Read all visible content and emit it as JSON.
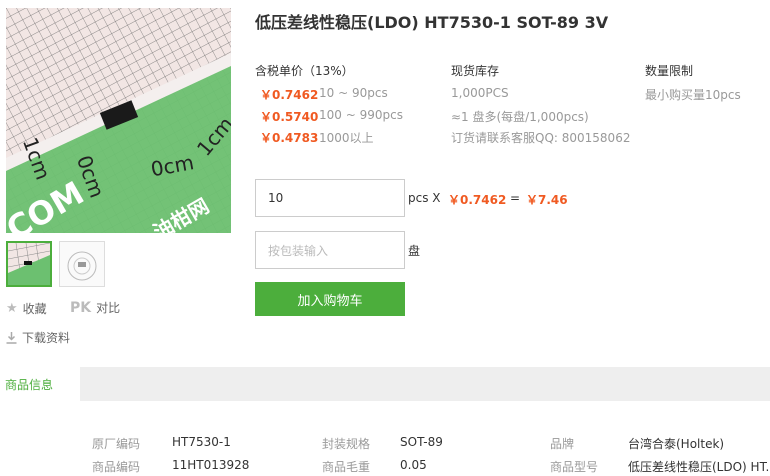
{
  "product": {
    "title": "低压差线性稳压(LDO) HT7530-1 SOT-89 3V",
    "image_text": {
      "cm_a": "1cm",
      "cm_b": "0cm",
      "cm_c": "0cm",
      "cm_d": "1cm",
      "brand": "COM",
      "brand_cn": "油柑网"
    }
  },
  "sidebar": {
    "favorite_label": "收藏",
    "pk_label": "PK",
    "compare_label": "对比",
    "download_label": "下载资料"
  },
  "pricing": {
    "header": "含税单价（13%）",
    "tiers": [
      {
        "price": "￥0.7462",
        "range": "10 ~ 90pcs"
      },
      {
        "price": "￥0.5740",
        "range": "100 ~ 990pcs"
      },
      {
        "price": "￥0.4783",
        "range": "1000以上"
      }
    ]
  },
  "stock": {
    "header": "现货库存",
    "quantity": "1,000PCS",
    "reels": "≈1 盘多(每盘/1,000pcs)",
    "contact": "订货请联系客服QQ: 800158062"
  },
  "limit": {
    "header": "数量限制",
    "min": "最小购买量10pcs"
  },
  "order": {
    "qty_value": "10",
    "unit": "pcs X",
    "unit_price": "￥0.7462",
    "equals": "=",
    "total": "￥7.46",
    "reel_placeholder": "按包装输入",
    "reel_unit": "盘",
    "add_to_cart": "加入购物车"
  },
  "tabs": {
    "active": "商品信息"
  },
  "specs": [
    {
      "label": "原厂编码",
      "value": "HT7530-1"
    },
    {
      "label": "封装规格",
      "value": "SOT-89"
    },
    {
      "label": "品牌",
      "value": "台湾合泰(Holtek)"
    },
    {
      "label": "商品编码",
      "value": "11HT013928"
    },
    {
      "label": "商品毛重",
      "value": "0.05"
    },
    {
      "label": "商品型号",
      "value": "低压差线性稳压(LDO) HT..."
    }
  ],
  "colors": {
    "accent": "#4cae3c",
    "price": "#f05a22",
    "tabbar": "#eeeeee"
  }
}
